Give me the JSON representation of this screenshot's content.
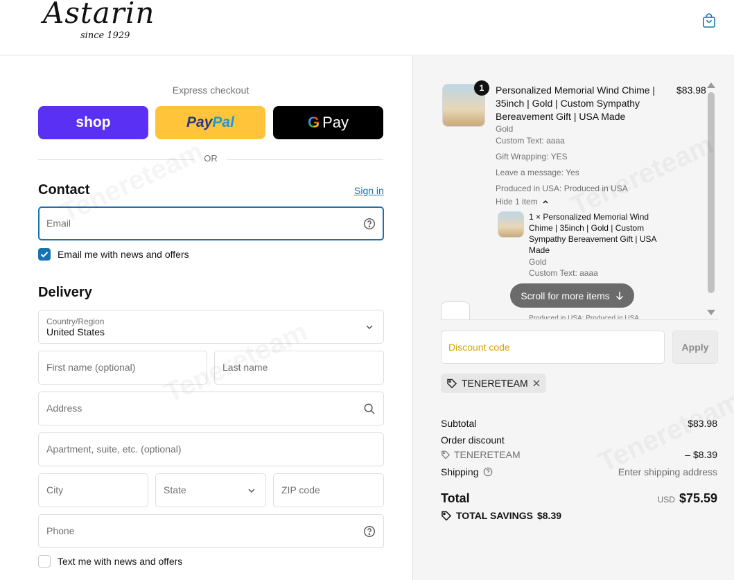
{
  "brand": {
    "logo_text": "Astarin",
    "logo_sub": "since 1929"
  },
  "header": {
    "cart_icon": "shopping-bag-icon"
  },
  "express": {
    "label": "Express checkout",
    "shop": "shop",
    "paypal_a": "Pay",
    "paypal_b": "Pal",
    "gpay_g": "G",
    "gpay_text": "Pay",
    "or": "OR"
  },
  "contact": {
    "title": "Contact",
    "signin": "Sign in",
    "email_placeholder": "Email",
    "news_label": "Email me with news and offers",
    "news_checked": true
  },
  "delivery": {
    "title": "Delivery",
    "country_label": "Country/Region",
    "country_value": "United States",
    "first_name": "First name (optional)",
    "last_name": "Last name",
    "address": "Address",
    "apartment": "Apartment, suite, etc. (optional)",
    "city": "City",
    "state": "State",
    "zip": "ZIP code",
    "phone": "Phone",
    "sms_label": "Text me with news and offers"
  },
  "summary": {
    "item": {
      "qty": "1",
      "title": "Personalized Memorial Wind Chime | 35inch | Gold | Custom Sympathy Bereavement Gift | USA Made",
      "price": "$83.98",
      "variant": "Gold",
      "custom_text": "Custom Text: aaaa",
      "gift_wrap": "Gift Wrapping: YES",
      "message": "Leave a message: Yes",
      "produced": "Produced in USA: Produced in USA",
      "hide": "Hide 1 item",
      "sub_title": "1 × Personalized Memorial Wind Chime | 35inch | Gold | Custom Sympathy Bereavement Gift | USA Made",
      "sub_variant": "Gold",
      "sub_custom": "Custom Text: aaaa",
      "sub_cut": "Produced in USA: Produced in USA"
    },
    "scroll_pill": "Scroll for more items",
    "discount_placeholder": "Discount code",
    "apply": "Apply",
    "code": "TENERETEAM",
    "subtotal_label": "Subtotal",
    "subtotal": "$83.98",
    "order_discount_label": "Order discount",
    "discount_code": "TENERETEAM",
    "discount_value": "– $8.39",
    "shipping_label": "Shipping",
    "shipping_value": "Enter shipping address",
    "total_label": "Total",
    "currency": "USD",
    "total": "$75.59",
    "savings_label": "TOTAL SAVINGS",
    "savings": "$8.39"
  },
  "colors": {
    "accent": "#1773b0",
    "shop": "#5a31f4",
    "paypal": "#ffc439",
    "gpay": "#000000",
    "summary_bg": "#f5f5f5"
  }
}
